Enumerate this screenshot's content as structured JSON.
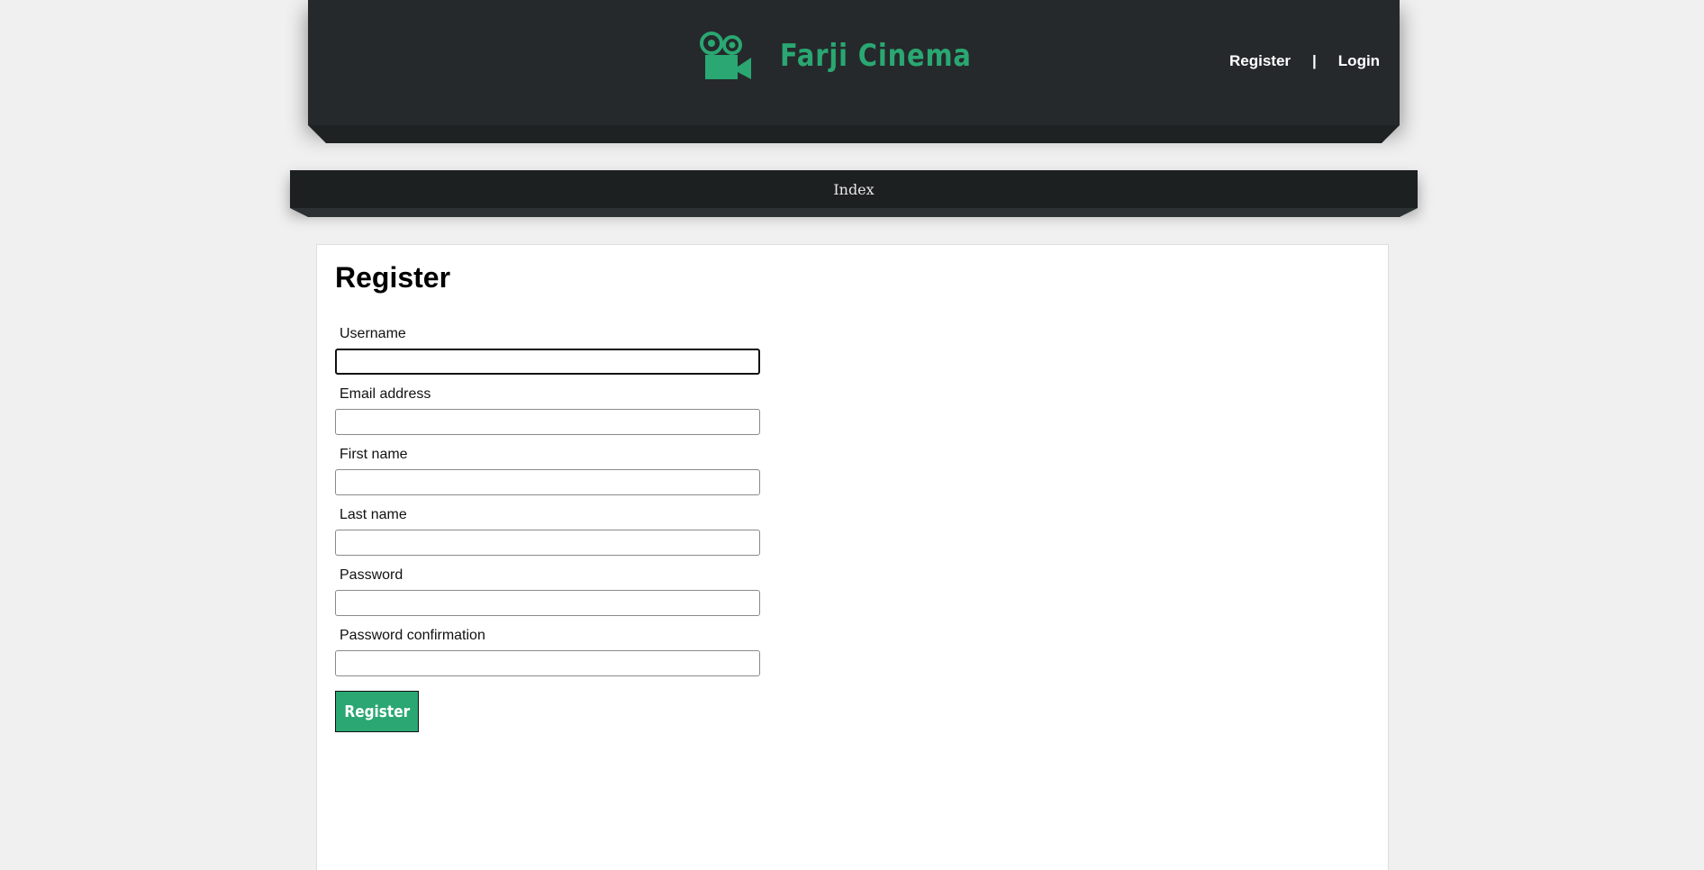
{
  "header": {
    "brand_name": "Farji Cinema",
    "brand_color": "#2aa772",
    "logo_icon": "movie-camera-icon",
    "register_link": "Register",
    "separator": "|",
    "login_link": "Login"
  },
  "nav": {
    "index_link": "Index"
  },
  "form": {
    "title": "Register",
    "fields": [
      {
        "label": "Username",
        "value": ""
      },
      {
        "label": "Email address",
        "value": ""
      },
      {
        "label": "First name",
        "value": ""
      },
      {
        "label": "Last name",
        "value": ""
      },
      {
        "label": "Password",
        "value": ""
      },
      {
        "label": "Password confirmation",
        "value": ""
      }
    ],
    "submit_label": "Register"
  }
}
